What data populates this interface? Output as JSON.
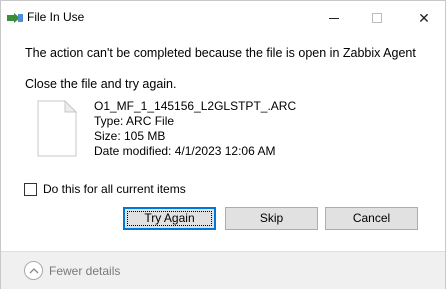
{
  "window": {
    "title": "File In Use",
    "minimize_label": "Minimize",
    "maximize_label": "Maximize",
    "close_glyph": "✕"
  },
  "message": {
    "main": "The action can't be completed because the file is open in Zabbix Agent",
    "sub": "Close the file and try again."
  },
  "file": {
    "name": "O1_MF_1_145156_L2GLSTPT_.ARC",
    "type": "Type: ARC File",
    "size": "Size: 105 MB",
    "modified": "Date modified: 4/1/2023 12:06 AM",
    "icon": "blank-document-icon"
  },
  "options": {
    "do_for_all_label": "Do this for all current items",
    "do_for_all_checked": false
  },
  "buttons": {
    "try_again": "Try Again",
    "skip": "Skip",
    "cancel": "Cancel"
  },
  "footer": {
    "fewer_details": "Fewer details",
    "icon": "chevron-up-icon"
  },
  "colors": {
    "accent": "#0078d7",
    "footer_bg": "#f0f0f0",
    "button_bg": "#e1e1e1"
  }
}
